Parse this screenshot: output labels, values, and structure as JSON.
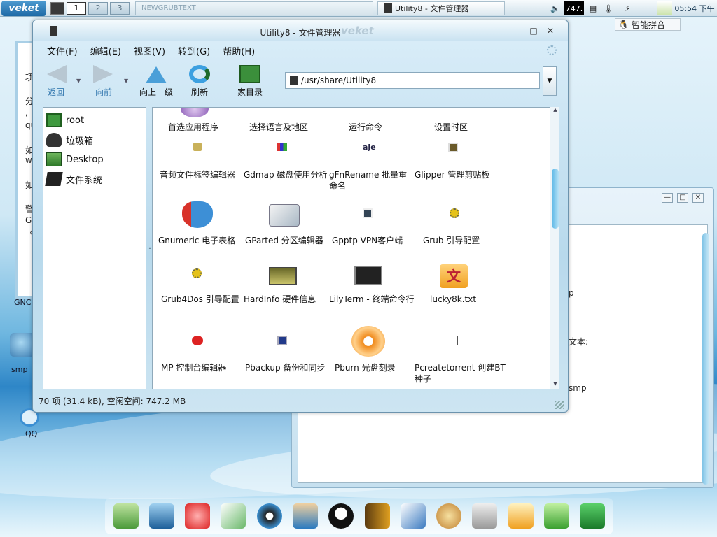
{
  "taskbar": {
    "logo_text": "veket",
    "workspaces": [
      "1",
      "2",
      "3"
    ],
    "inactive_task": "NEWGRUBTEXT",
    "active_task": "Utility8 - 文件管理器",
    "volume_number": "747.",
    "clock": "05:54  下午"
  },
  "ime": {
    "label": "智能拼音"
  },
  "desktop": {
    "labels": {
      "gnc": "GNC",
      "smplay": "smp",
      "qq": "QQ"
    },
    "left_window_chars": [
      "项",
      "分",
      ",",
      "qu",
      "如",
      "w",
      "如",
      "警",
      "G",
      "〈"
    ],
    "right_window_texts": [
      "p",
      "文本:",
      "smp"
    ]
  },
  "window": {
    "title": "Utility8 - 文件管理器",
    "brand": "veket",
    "min_label": "—",
    "max_label": "□",
    "close_label": "✕",
    "menu": [
      "文件(F)",
      "编辑(E)",
      "视图(V)",
      "转到(G)",
      "帮助(H)"
    ],
    "toolbar": {
      "back": "返回",
      "forward": "向前",
      "up": "向上一级",
      "refresh": "刷新",
      "home": "家目录"
    },
    "address": "/usr/share/Utility8",
    "sidebar": [
      "root",
      "垃圾箱",
      "Desktop",
      "文件系统"
    ],
    "items": [
      {
        "label": "首选应用程序",
        "icon": "preferences-icon"
      },
      {
        "label": "选择语言及地区",
        "icon": "language-icon"
      },
      {
        "label": "运行命令",
        "icon": "run-icon"
      },
      {
        "label": "设置时区",
        "icon": "timezone-icon"
      },
      {
        "label": "音频文件标签编辑器",
        "icon": "audio-tag-icon"
      },
      {
        "label": "Gdmap 磁盘使用分析",
        "icon": "disk-chart-icon"
      },
      {
        "label": "gFnRename 批量重命名",
        "icon": "rename-icon"
      },
      {
        "label": "Glipper 管理剪贴板",
        "icon": "clipboard-icon"
      },
      {
        "label": "Gnumeric 电子表格",
        "icon": "spreadsheet-icon"
      },
      {
        "label": "GParted 分区编辑器",
        "icon": "partition-icon"
      },
      {
        "label": "Gpptp VPN客户端",
        "icon": "vpn-icon"
      },
      {
        "label": "Grub 引导配置",
        "icon": "grub-icon"
      },
      {
        "label": "Grub4Dos 引导配置",
        "icon": "grub4dos-icon"
      },
      {
        "label": "HardInfo 硬件信息",
        "icon": "hardware-icon"
      },
      {
        "label": "LilyTerm - 终端命令行",
        "icon": "terminal-icon"
      },
      {
        "label": "lucky8k.txt",
        "icon": "text-file-icon"
      },
      {
        "label": "MP 控制台编辑器",
        "icon": "mp-icon"
      },
      {
        "label": "Pbackup 备份和同步",
        "icon": "backup-icon"
      },
      {
        "label": "Pburn 光盘刻录",
        "icon": "burn-icon"
      },
      {
        "label": "Pcreatetorrent 创建BT种子",
        "icon": "torrent-icon"
      }
    ],
    "status": "70 项 (31.4 kB), 空闲空间: 747.2 MB"
  },
  "colors": {
    "accent": "#2f86c7",
    "gnumeric_red": "#d8322a",
    "gnumeric_blue": "#3d8fd6",
    "burn_orange": "#f08a1c",
    "lucky_orange": "#f0a020"
  }
}
